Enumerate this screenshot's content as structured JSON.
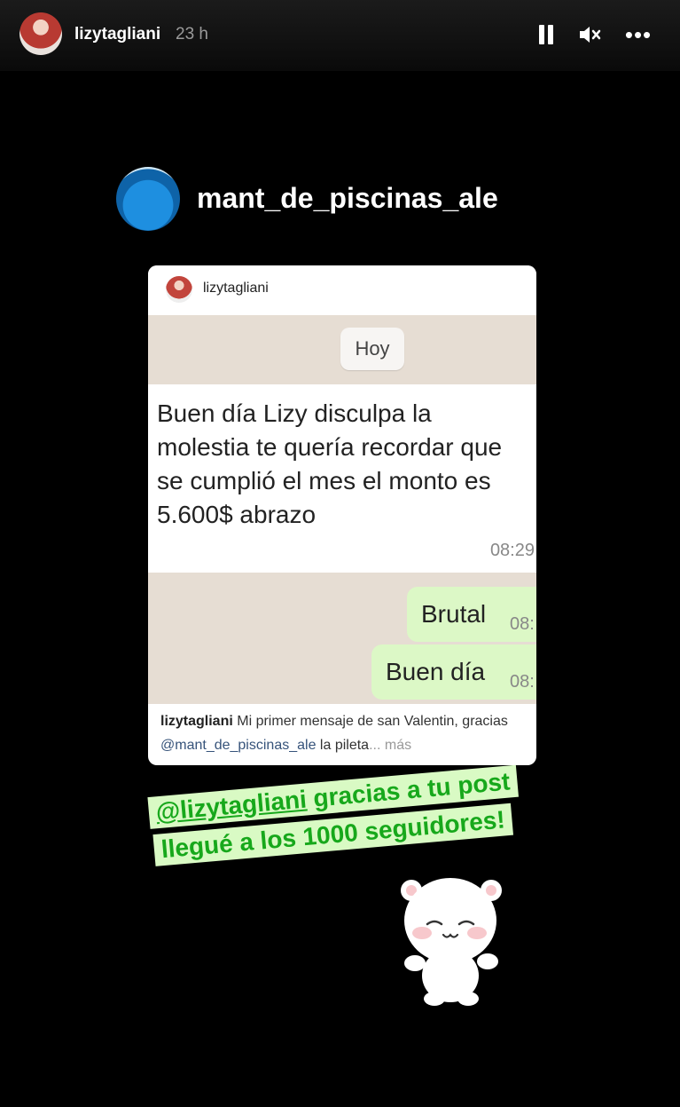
{
  "story_header": {
    "username": "lizytagliani",
    "time_ago": "23 h",
    "icons": [
      "pause-icon",
      "mute-icon",
      "more-icon"
    ]
  },
  "repost": {
    "username": "mant_de_piscinas_ale"
  },
  "embedded_post": {
    "username": "lizytagliani",
    "chat": {
      "date_label": "Hoy",
      "incoming_message": "Buen día Lizy disculpa la molestia te quería recordar que se cumplió el mes el monto es 5.600$ abrazo",
      "incoming_time": "08:29",
      "outgoing": [
        {
          "text": "Brutal",
          "time": "08:"
        },
        {
          "text": "Buen día",
          "time": "08:"
        }
      ]
    },
    "caption": {
      "username": "lizytagliani",
      "text_part1": "Mi primer mensaje de san Valentin, gracias",
      "mention": "@mant_de_piscinas_ale",
      "text_part2": "la pileta",
      "more": "... más"
    }
  },
  "sticker_text": {
    "mention": "@lizytagliani",
    "line1_rest": "gracias a tu post",
    "line2": "llegué a los 1000 seguidores!"
  },
  "colors": {
    "background": "#000000",
    "chat_bg": "#e6ddd3",
    "outgoing_bubble": "#dcf8c6",
    "sticker_bg": "#d9fac4",
    "sticker_text": "#17a81b"
  }
}
